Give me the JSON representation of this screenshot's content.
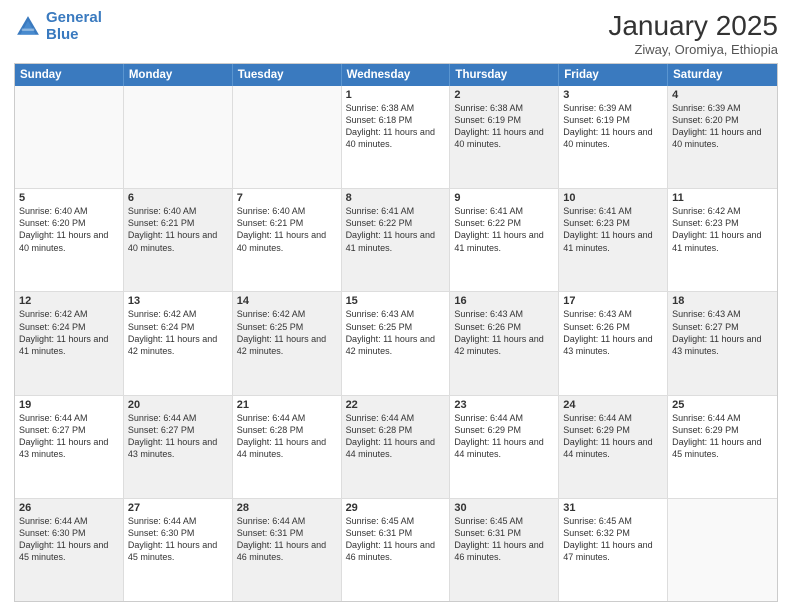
{
  "header": {
    "logo_line1": "General",
    "logo_line2": "Blue",
    "month": "January 2025",
    "location": "Ziway, Oromiya, Ethiopia"
  },
  "days_of_week": [
    "Sunday",
    "Monday",
    "Tuesday",
    "Wednesday",
    "Thursday",
    "Friday",
    "Saturday"
  ],
  "rows": [
    [
      {
        "num": "",
        "text": "",
        "empty": true
      },
      {
        "num": "",
        "text": "",
        "empty": true
      },
      {
        "num": "",
        "text": "",
        "empty": true
      },
      {
        "num": "1",
        "text": "Sunrise: 6:38 AM\nSunset: 6:18 PM\nDaylight: 11 hours\nand 40 minutes.",
        "shaded": false
      },
      {
        "num": "2",
        "text": "Sunrise: 6:38 AM\nSunset: 6:19 PM\nDaylight: 11 hours\nand 40 minutes.",
        "shaded": true
      },
      {
        "num": "3",
        "text": "Sunrise: 6:39 AM\nSunset: 6:19 PM\nDaylight: 11 hours\nand 40 minutes.",
        "shaded": false
      },
      {
        "num": "4",
        "text": "Sunrise: 6:39 AM\nSunset: 6:20 PM\nDaylight: 11 hours\nand 40 minutes.",
        "shaded": true
      }
    ],
    [
      {
        "num": "5",
        "text": "Sunrise: 6:40 AM\nSunset: 6:20 PM\nDaylight: 11 hours\nand 40 minutes.",
        "shaded": false
      },
      {
        "num": "6",
        "text": "Sunrise: 6:40 AM\nSunset: 6:21 PM\nDaylight: 11 hours\nand 40 minutes.",
        "shaded": true
      },
      {
        "num": "7",
        "text": "Sunrise: 6:40 AM\nSunset: 6:21 PM\nDaylight: 11 hours\nand 40 minutes.",
        "shaded": false
      },
      {
        "num": "8",
        "text": "Sunrise: 6:41 AM\nSunset: 6:22 PM\nDaylight: 11 hours\nand 41 minutes.",
        "shaded": true
      },
      {
        "num": "9",
        "text": "Sunrise: 6:41 AM\nSunset: 6:22 PM\nDaylight: 11 hours\nand 41 minutes.",
        "shaded": false
      },
      {
        "num": "10",
        "text": "Sunrise: 6:41 AM\nSunset: 6:23 PM\nDaylight: 11 hours\nand 41 minutes.",
        "shaded": true
      },
      {
        "num": "11",
        "text": "Sunrise: 6:42 AM\nSunset: 6:23 PM\nDaylight: 11 hours\nand 41 minutes.",
        "shaded": false
      }
    ],
    [
      {
        "num": "12",
        "text": "Sunrise: 6:42 AM\nSunset: 6:24 PM\nDaylight: 11 hours\nand 41 minutes.",
        "shaded": true
      },
      {
        "num": "13",
        "text": "Sunrise: 6:42 AM\nSunset: 6:24 PM\nDaylight: 11 hours\nand 42 minutes.",
        "shaded": false
      },
      {
        "num": "14",
        "text": "Sunrise: 6:42 AM\nSunset: 6:25 PM\nDaylight: 11 hours\nand 42 minutes.",
        "shaded": true
      },
      {
        "num": "15",
        "text": "Sunrise: 6:43 AM\nSunset: 6:25 PM\nDaylight: 11 hours\nand 42 minutes.",
        "shaded": false
      },
      {
        "num": "16",
        "text": "Sunrise: 6:43 AM\nSunset: 6:26 PM\nDaylight: 11 hours\nand 42 minutes.",
        "shaded": true
      },
      {
        "num": "17",
        "text": "Sunrise: 6:43 AM\nSunset: 6:26 PM\nDaylight: 11 hours\nand 43 minutes.",
        "shaded": false
      },
      {
        "num": "18",
        "text": "Sunrise: 6:43 AM\nSunset: 6:27 PM\nDaylight: 11 hours\nand 43 minutes.",
        "shaded": true
      }
    ],
    [
      {
        "num": "19",
        "text": "Sunrise: 6:44 AM\nSunset: 6:27 PM\nDaylight: 11 hours\nand 43 minutes.",
        "shaded": false
      },
      {
        "num": "20",
        "text": "Sunrise: 6:44 AM\nSunset: 6:27 PM\nDaylight: 11 hours\nand 43 minutes.",
        "shaded": true
      },
      {
        "num": "21",
        "text": "Sunrise: 6:44 AM\nSunset: 6:28 PM\nDaylight: 11 hours\nand 44 minutes.",
        "shaded": false
      },
      {
        "num": "22",
        "text": "Sunrise: 6:44 AM\nSunset: 6:28 PM\nDaylight: 11 hours\nand 44 minutes.",
        "shaded": true
      },
      {
        "num": "23",
        "text": "Sunrise: 6:44 AM\nSunset: 6:29 PM\nDaylight: 11 hours\nand 44 minutes.",
        "shaded": false
      },
      {
        "num": "24",
        "text": "Sunrise: 6:44 AM\nSunset: 6:29 PM\nDaylight: 11 hours\nand 44 minutes.",
        "shaded": true
      },
      {
        "num": "25",
        "text": "Sunrise: 6:44 AM\nSunset: 6:29 PM\nDaylight: 11 hours\nand 45 minutes.",
        "shaded": false
      }
    ],
    [
      {
        "num": "26",
        "text": "Sunrise: 6:44 AM\nSunset: 6:30 PM\nDaylight: 11 hours\nand 45 minutes.",
        "shaded": true
      },
      {
        "num": "27",
        "text": "Sunrise: 6:44 AM\nSunset: 6:30 PM\nDaylight: 11 hours\nand 45 minutes.",
        "shaded": false
      },
      {
        "num": "28",
        "text": "Sunrise: 6:44 AM\nSunset: 6:31 PM\nDaylight: 11 hours\nand 46 minutes.",
        "shaded": true
      },
      {
        "num": "29",
        "text": "Sunrise: 6:45 AM\nSunset: 6:31 PM\nDaylight: 11 hours\nand 46 minutes.",
        "shaded": false
      },
      {
        "num": "30",
        "text": "Sunrise: 6:45 AM\nSunset: 6:31 PM\nDaylight: 11 hours\nand 46 minutes.",
        "shaded": true
      },
      {
        "num": "31",
        "text": "Sunrise: 6:45 AM\nSunset: 6:32 PM\nDaylight: 11 hours\nand 47 minutes.",
        "shaded": false
      },
      {
        "num": "",
        "text": "",
        "empty": true
      }
    ]
  ]
}
